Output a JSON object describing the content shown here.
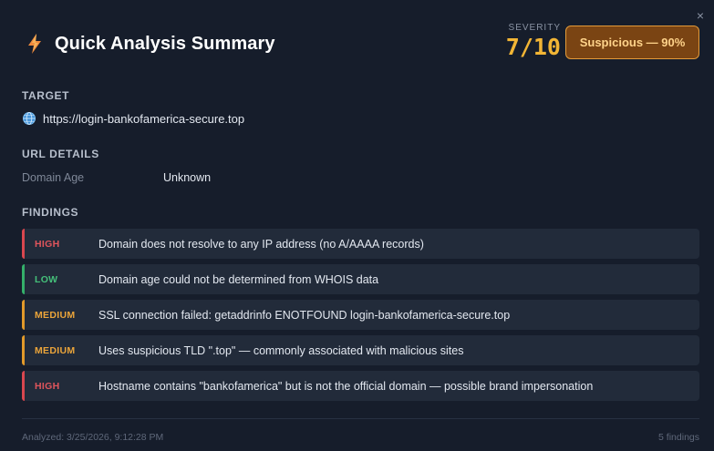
{
  "header": {
    "title": "Quick Analysis Summary",
    "severity_label": "SEVERITY",
    "severity_value": "7/10",
    "verdict_badge": "Suspicious — 90%",
    "close_glyph": "×"
  },
  "target": {
    "section_title": "TARGET",
    "url": "https://login-bankofamerica-secure.top",
    "icon": "globe-icon"
  },
  "url_details": {
    "section_title": "URL DETAILS",
    "rows": [
      {
        "key": "Domain Age",
        "value": "Unknown"
      }
    ]
  },
  "findings": {
    "section_title": "FINDINGS",
    "items": [
      {
        "level": "HIGH",
        "text": "Domain does not resolve to any IP address (no A/AAAA records)"
      },
      {
        "level": "LOW",
        "text": "Domain age could not be determined from WHOIS data"
      },
      {
        "level": "MEDIUM",
        "text": "SSL connection failed: getaddrinfo ENOTFOUND login-bankofamerica-secure.top"
      },
      {
        "level": "MEDIUM",
        "text": "Uses suspicious TLD \".top\" — commonly associated with malicious sites"
      },
      {
        "level": "HIGH",
        "text": "Hostname contains \"bankofamerica\" but is not the official domain — possible brand impersonation"
      }
    ]
  },
  "footer": {
    "analyzed": "Analyzed: 3/25/2026, 9:12:28 PM",
    "count": "5 findings"
  },
  "colors": {
    "background": "#161d2b",
    "severity": "#f2b535",
    "badge_bg": "#7a4413",
    "badge_border": "#e39b3a",
    "high": "#d9474f",
    "medium": "#e29a2a",
    "low": "#34b06a"
  }
}
